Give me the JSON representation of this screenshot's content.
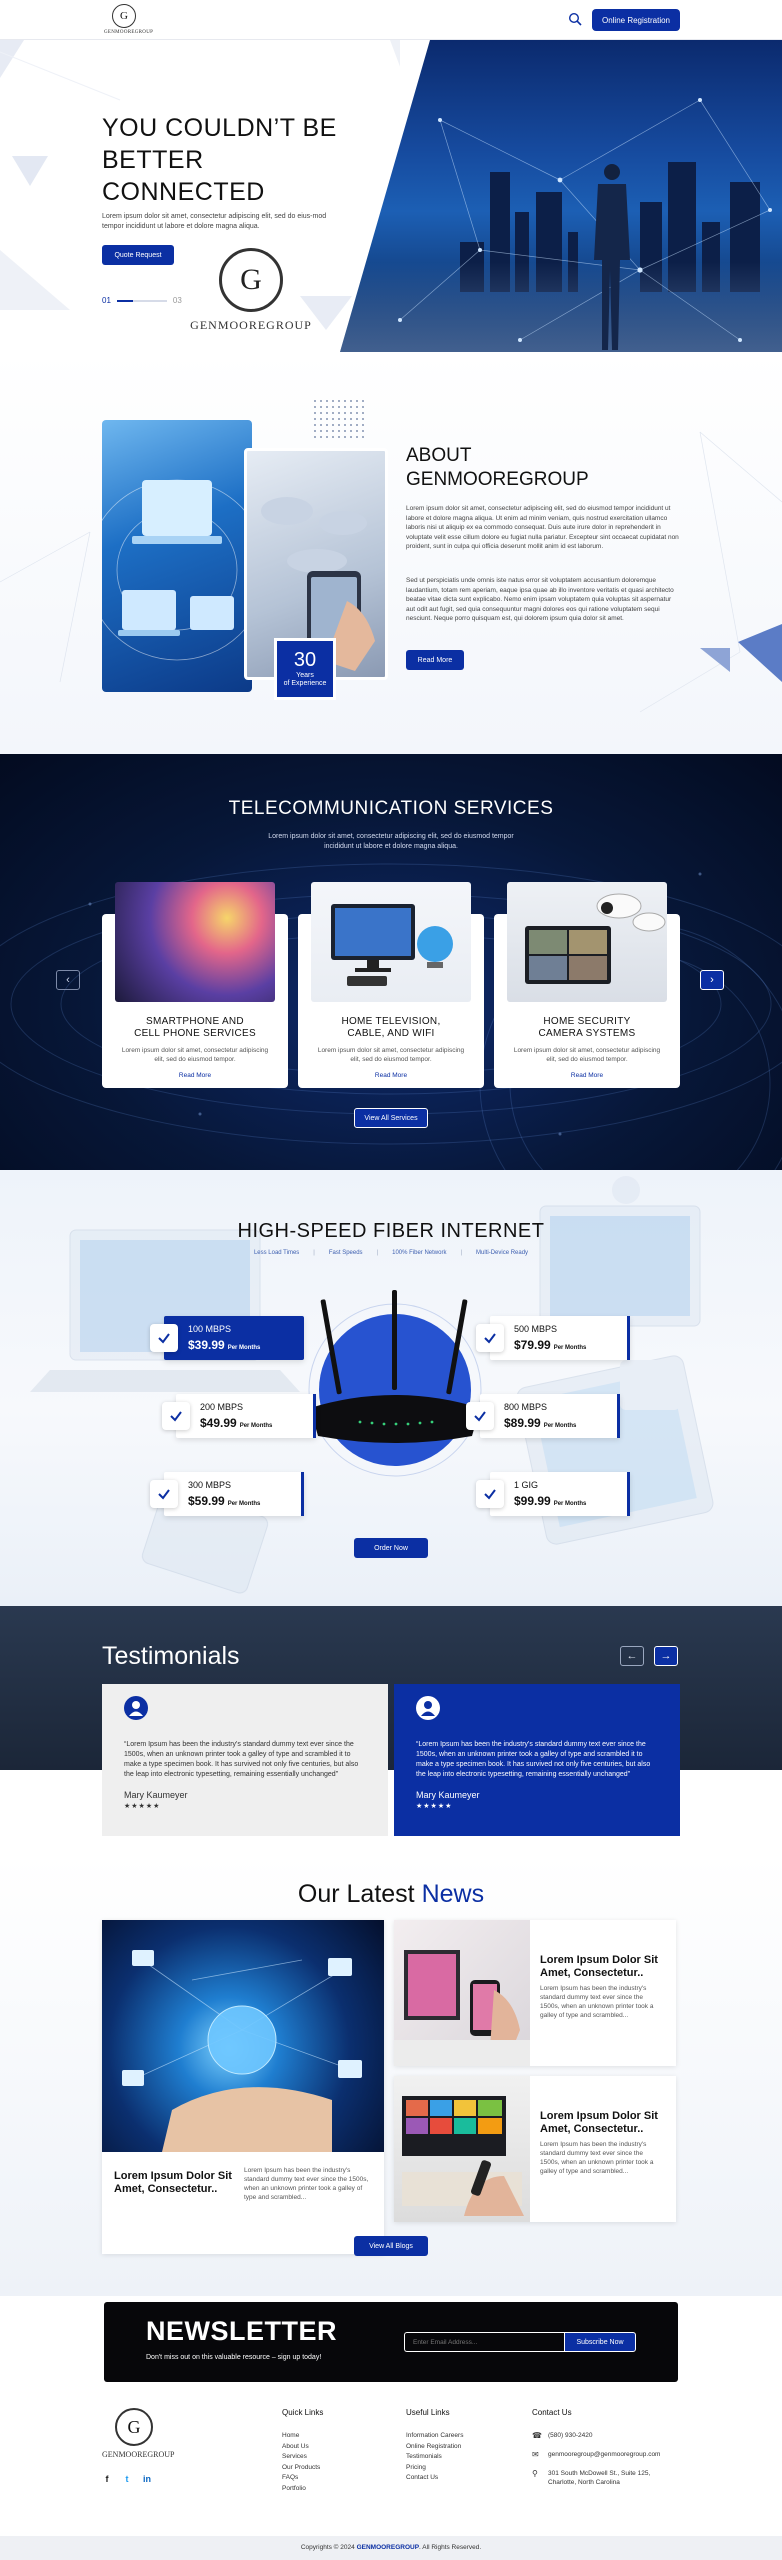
{
  "header": {
    "logo_text": "GENMOOREGROUP",
    "online_registration": "Online Registration"
  },
  "hero": {
    "title_lines": [
      "YOU COULDN’T BE",
      "BETTER",
      "CONNECTED"
    ],
    "text": "Lorem ipsum dolor sit amet, consectetur adipiscing elit, sed do eius-mod tempor incididunt ut labore et dolore magna aliqua.",
    "button": "Quote Request",
    "pager_start": "01",
    "pager_end": "03",
    "pager_progress": 0.33,
    "logo_text": "GENMOOREGROUP"
  },
  "about": {
    "title_lines": [
      "ABOUT",
      "GENMOOREGROUP"
    ],
    "para1": "Lorem ipsum dolor sit amet, consectetur adipiscing elit, sed do eiusmod tempor incididunt ut labore et dolore magna aliqua. Ut enim ad minim veniam, quis nostrud exercitation ullamco laboris nisi ut aliquip ex ea commodo consequat. Duis aute irure dolor in reprehenderit in voluptate velit esse cillum dolore eu fugiat nulla pariatur. Excepteur sint occaecat cupidatat non proident, sunt in culpa qui officia deserunt mollit anim id est laborum.",
    "para2": "Sed ut perspiciatis unde omnis iste natus error sit voluptatem accusantium doloremque laudantium, totam rem aperiam, eaque ipsa quae ab illo inventore veritatis et quasi architecto beatae vitae dicta sunt explicabo. Nemo enim ipsam voluptatem quia voluptas sit aspernatur aut odit aut fugit, sed quia consequuntur magni dolores eos qui ratione voluptatem sequi nesciunt. Neque porro quisquam est, qui dolorem ipsum quia dolor sit amet.",
    "button": "Read More",
    "exp_number": "30",
    "exp_label_1": "Years",
    "exp_label_2": "of Experience"
  },
  "services": {
    "title": "TELECOMMUNICATION SERVICES",
    "subtitle": "Lorem ipsum dolor sit amet, consectetur adipiscing elit, sed do eiusmod tempor incididunt ut labore et dolore magna aliqua.",
    "cards": [
      {
        "name1": "SMARTPHONE AND",
        "name2": "CELL PHONE SERVICES",
        "desc": "Lorem ipsum dolor sit amet, consectetur adipiscing elit, sed do eiusmod tempor.",
        "more": "Read More"
      },
      {
        "name1": "HOME TELEVISION,",
        "name2": "CABLE, AND WIFI",
        "desc": "Lorem ipsum dolor sit amet, consectetur adipiscing elit, sed do eiusmod tempor.",
        "more": "Read More"
      },
      {
        "name1": "HOME SECURITY",
        "name2": "CAMERA SYSTEMS",
        "desc": "Lorem ipsum dolor sit amet, consectetur adipiscing elit, sed do eiusmod tempor.",
        "more": "Read More"
      }
    ],
    "prev": "‹",
    "next": "›",
    "view_all": "View All Services"
  },
  "fiber": {
    "title": "HIGH-SPEED FIBER INTERNET",
    "tags": [
      "Less Load Times",
      "Fast Speeds",
      "100% Fiber Network",
      "Multi-Device Ready"
    ],
    "plans": [
      {
        "speed": "100 MBPS",
        "price": "$39.99",
        "per": "Per Months"
      },
      {
        "speed": "200 MBPS",
        "price": "$49.99",
        "per": "Per Months"
      },
      {
        "speed": "300 MBPS",
        "price": "$59.99",
        "per": "Per Months"
      },
      {
        "speed": "500 MBPS",
        "price": "$79.99",
        "per": "Per Months"
      },
      {
        "speed": "800 MBPS",
        "price": "$89.99",
        "per": "Per Months"
      },
      {
        "speed": "1 GIG",
        "price": "$99.99",
        "per": "Per Months"
      }
    ],
    "button": "Order Now"
  },
  "testimonials": {
    "title": "Testimonials",
    "prev": "←",
    "next": "→",
    "items": [
      {
        "quote": "“Lorem Ipsum has been the industry's standard dummy text ever since the 1500s, when an unknown printer took a galley of type and scrambled it to make a type specimen book. It has survived not only five centuries, but also the leap into electronic typesetting, remaining essentially unchanged”",
        "name": "Mary Kaumeyer",
        "stars": "★★★★★"
      },
      {
        "quote": "“Lorem Ipsum has been the industry's standard dummy text ever since the 1500s, when an unknown printer took a galley of type and scrambled it to make a type specimen book. It has survived not only five centuries, but also the leap into electronic typesetting, remaining essentially unchanged”",
        "name": "Mary Kaumeyer",
        "stars": "★★★★★"
      }
    ]
  },
  "news": {
    "title_a": "Our Latest ",
    "title_b": "News",
    "big": {
      "heading": "Lorem Ipsum Dolor Sit Amet, Consectetur..",
      "text": "Lorem Ipsum has been the industry's standard dummy text ever since the 1500s, when an unknown printer took a galley of type and scrambled..."
    },
    "small": [
      {
        "heading": "Lorem Ipsum Dolor Sit Amet, Consectetur..",
        "text": "Lorem Ipsum has been the industry's standard dummy text ever since the 1500s, when an unknown printer took a galley of type and scrambled..."
      },
      {
        "heading": "Lorem Ipsum Dolor Sit Amet, Consectetur..",
        "text": "Lorem Ipsum has been the industry's standard dummy text ever since the 1500s, when an unknown printer took a galley of type and scrambled..."
      }
    ],
    "button": "View All Blogs"
  },
  "newsletter": {
    "title": "NEWSLETTER",
    "subtitle": "Don't miss out on this valuable resource – sign up today!",
    "placeholder": "Enter Email Address...",
    "button": "Subscribe Now"
  },
  "footer": {
    "logo_text": "GENMOOREGROUP",
    "social": [
      "f",
      "t",
      "in"
    ],
    "quick_links": {
      "title": "Quick Links",
      "items": [
        "Home",
        "About Us",
        "Services",
        "Our Products",
        "FAQs",
        "Portfolio"
      ]
    },
    "useful_links": {
      "title": "Useful Links",
      "items": [
        "Information Careers",
        "Online Registration",
        "Testimonials",
        "Pricing",
        "Contact Us"
      ]
    },
    "contact": {
      "title": "Contact Us",
      "phone": "(580) 930-2420",
      "email": "genmooregroup@genmooregroup.com",
      "address1": "301 South McDowell St., Suite 125,",
      "address2": "Charlotte, North Carolina"
    },
    "copyright_a": "Copyrights © 2024 ",
    "copyright_brand": "GENMOOREGROUP",
    "copyright_b": ". All Rights Reserved."
  },
  "colors": {
    "primary": "#0b2fa3",
    "dark": "#07070a",
    "services_bg": "#071738"
  }
}
